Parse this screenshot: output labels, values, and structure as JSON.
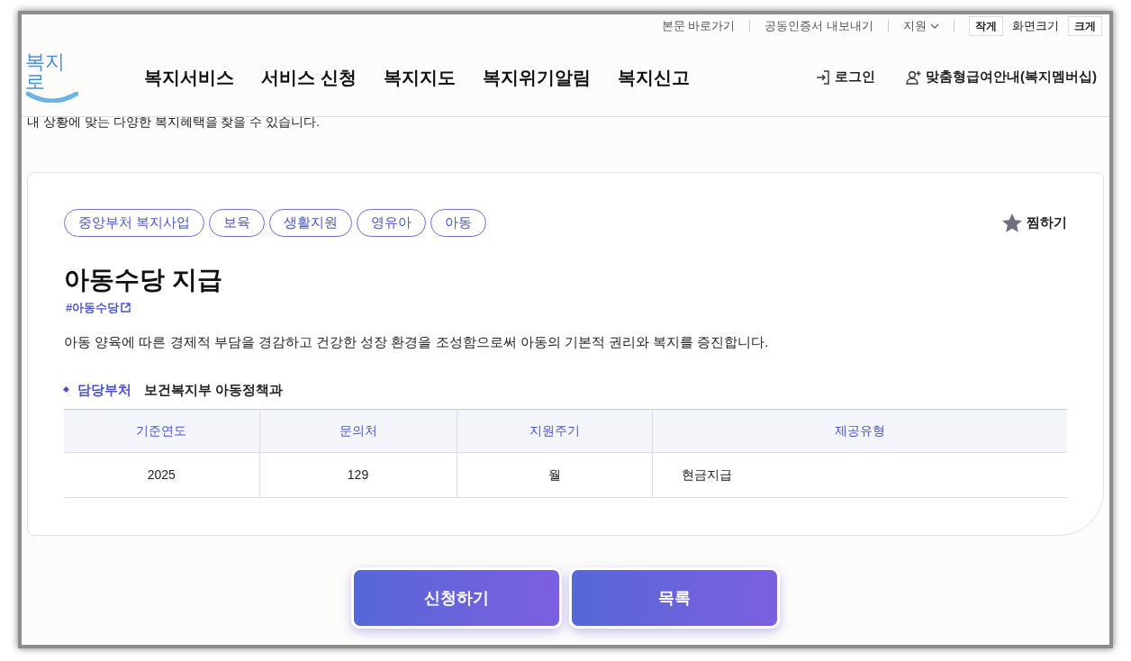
{
  "utility_links": [
    {
      "label": "본문 바로가기",
      "kind": "link"
    },
    {
      "label": "공동인증서 내보내기",
      "kind": "link"
    },
    {
      "label": "지원",
      "kind": "dropdown"
    }
  ],
  "font_size": {
    "smaller": "작게",
    "label": "화면크기",
    "larger": "크게"
  },
  "logo": "복지로",
  "nav": [
    "복지서비스",
    "서비스 신청",
    "복지지도",
    "복지위기알림",
    "복지신고"
  ],
  "account_links": [
    {
      "label": "로그인",
      "kind": "login"
    },
    {
      "label": "맞춤형급여안내(복지멤버십)",
      "kind": "member"
    }
  ],
  "intro_text": "내 상황에 맞는 다양한 복지혜택을 찾을 수 있습니다.",
  "service": {
    "tags": [
      "중앙부처 복지사업",
      "보육",
      "생활지원",
      "영유아",
      "아동"
    ],
    "bookmark": {
      "label": "찜하기",
      "selected": false
    },
    "title": "아동수당 지급",
    "hashtag": "#아동수당",
    "description": "아동 양육에 따른 경제적 부담을 경감하고 건강한 성장 환경을 조성함으로써 아동의 기본적 권리와 복지를 증진합니다.",
    "department": {
      "label": "담당부처",
      "value": "보건복지부 아동정책과"
    },
    "table": {
      "columns": [
        "기준연도",
        "문의처",
        "지원주기",
        "제공유형"
      ],
      "rows": [
        [
          "2025",
          "129",
          "월",
          "현금지급"
        ]
      ]
    }
  },
  "buttons": [
    "신청하기",
    "목록"
  ]
}
